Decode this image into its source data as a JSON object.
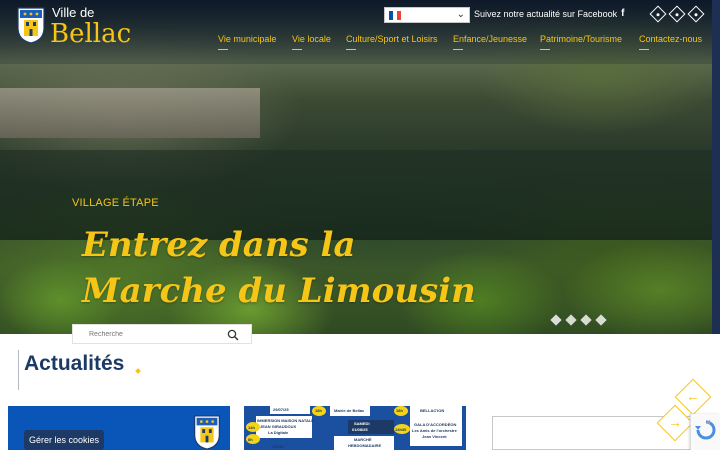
{
  "site": {
    "logo_small": "Ville de",
    "logo_big": "Bellac"
  },
  "topbar": {
    "language_flag": "french-flag",
    "facebook_text": "Suivez notre actualité sur Facebook",
    "facebook_icon": "f"
  },
  "nav": {
    "items": [
      {
        "label": "Vie municipale"
      },
      {
        "label": "Vie locale"
      },
      {
        "label": "Culture/Sport et Loisirs"
      },
      {
        "label": "Enfance/Jeunesse"
      },
      {
        "label": "Patrimoine/Tourisme"
      },
      {
        "label": "Contactez-nous"
      }
    ]
  },
  "hero": {
    "kicker": "VILLAGE ÉTAPE",
    "headline_line1": "Entrez dans la",
    "headline_line2": "Marche du Limousin",
    "slides": 4,
    "active_slide": 1
  },
  "search": {
    "placeholder": "Recherche"
  },
  "news": {
    "title": "Actualités",
    "cookie_button": "Gérer les cookies",
    "poster_texts": {
      "date1": "29/07/25",
      "t1": "Mairie de Bellac",
      "t2": "IMMERSION MAISON NATALE",
      "t3": "JEAN GIRAUDOUX",
      "t4": "La Digitale",
      "d2a": "SAMEDI",
      "d2b": "01/08/25",
      "t5": "MARCHÉ",
      "t6": "HEBDOMADAIRE",
      "t7": "BELLAC'ION",
      "t8": "GALA D'ACCORDÉON",
      "t9": "Les Amis de l'orchestre",
      "t10": "Jean Vincent",
      "h1": "18h",
      "h2": "14h",
      "h3": "8h",
      "h4": "18h",
      "h5": "14h30",
      "lbl_jeudi": "JEUDI"
    }
  },
  "colors": {
    "accent": "#f5c518",
    "navy": "#1d3a66",
    "blue_card": "#0a56b8"
  }
}
